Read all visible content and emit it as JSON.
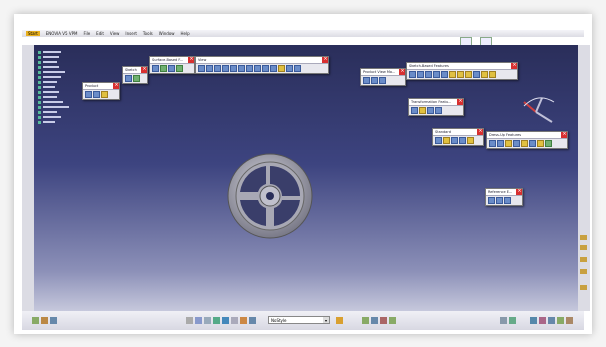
{
  "menubar": {
    "start": "Start",
    "items": [
      "ENOVIA V5 VPM",
      "File",
      "Edit",
      "View",
      "Insert",
      "Tools",
      "Window",
      "Help"
    ]
  },
  "toolbars": {
    "product": "Product",
    "sketch": "Sketch",
    "surface": "Surface-Based F...",
    "view": "View",
    "product_view": "Product View Mo...",
    "sketch_features": "Sketch-Based Features",
    "transform": "Transformation Featu...",
    "standard": "Standard",
    "dress_up": "Dress-Up Features",
    "reference": "Reference E..."
  },
  "bottombar": {
    "combo_value": "NoStyle"
  },
  "colors": {
    "viewport_top": "#2a2e5a",
    "viewport_bottom": "#c6c8dc",
    "close": "#d83030"
  }
}
